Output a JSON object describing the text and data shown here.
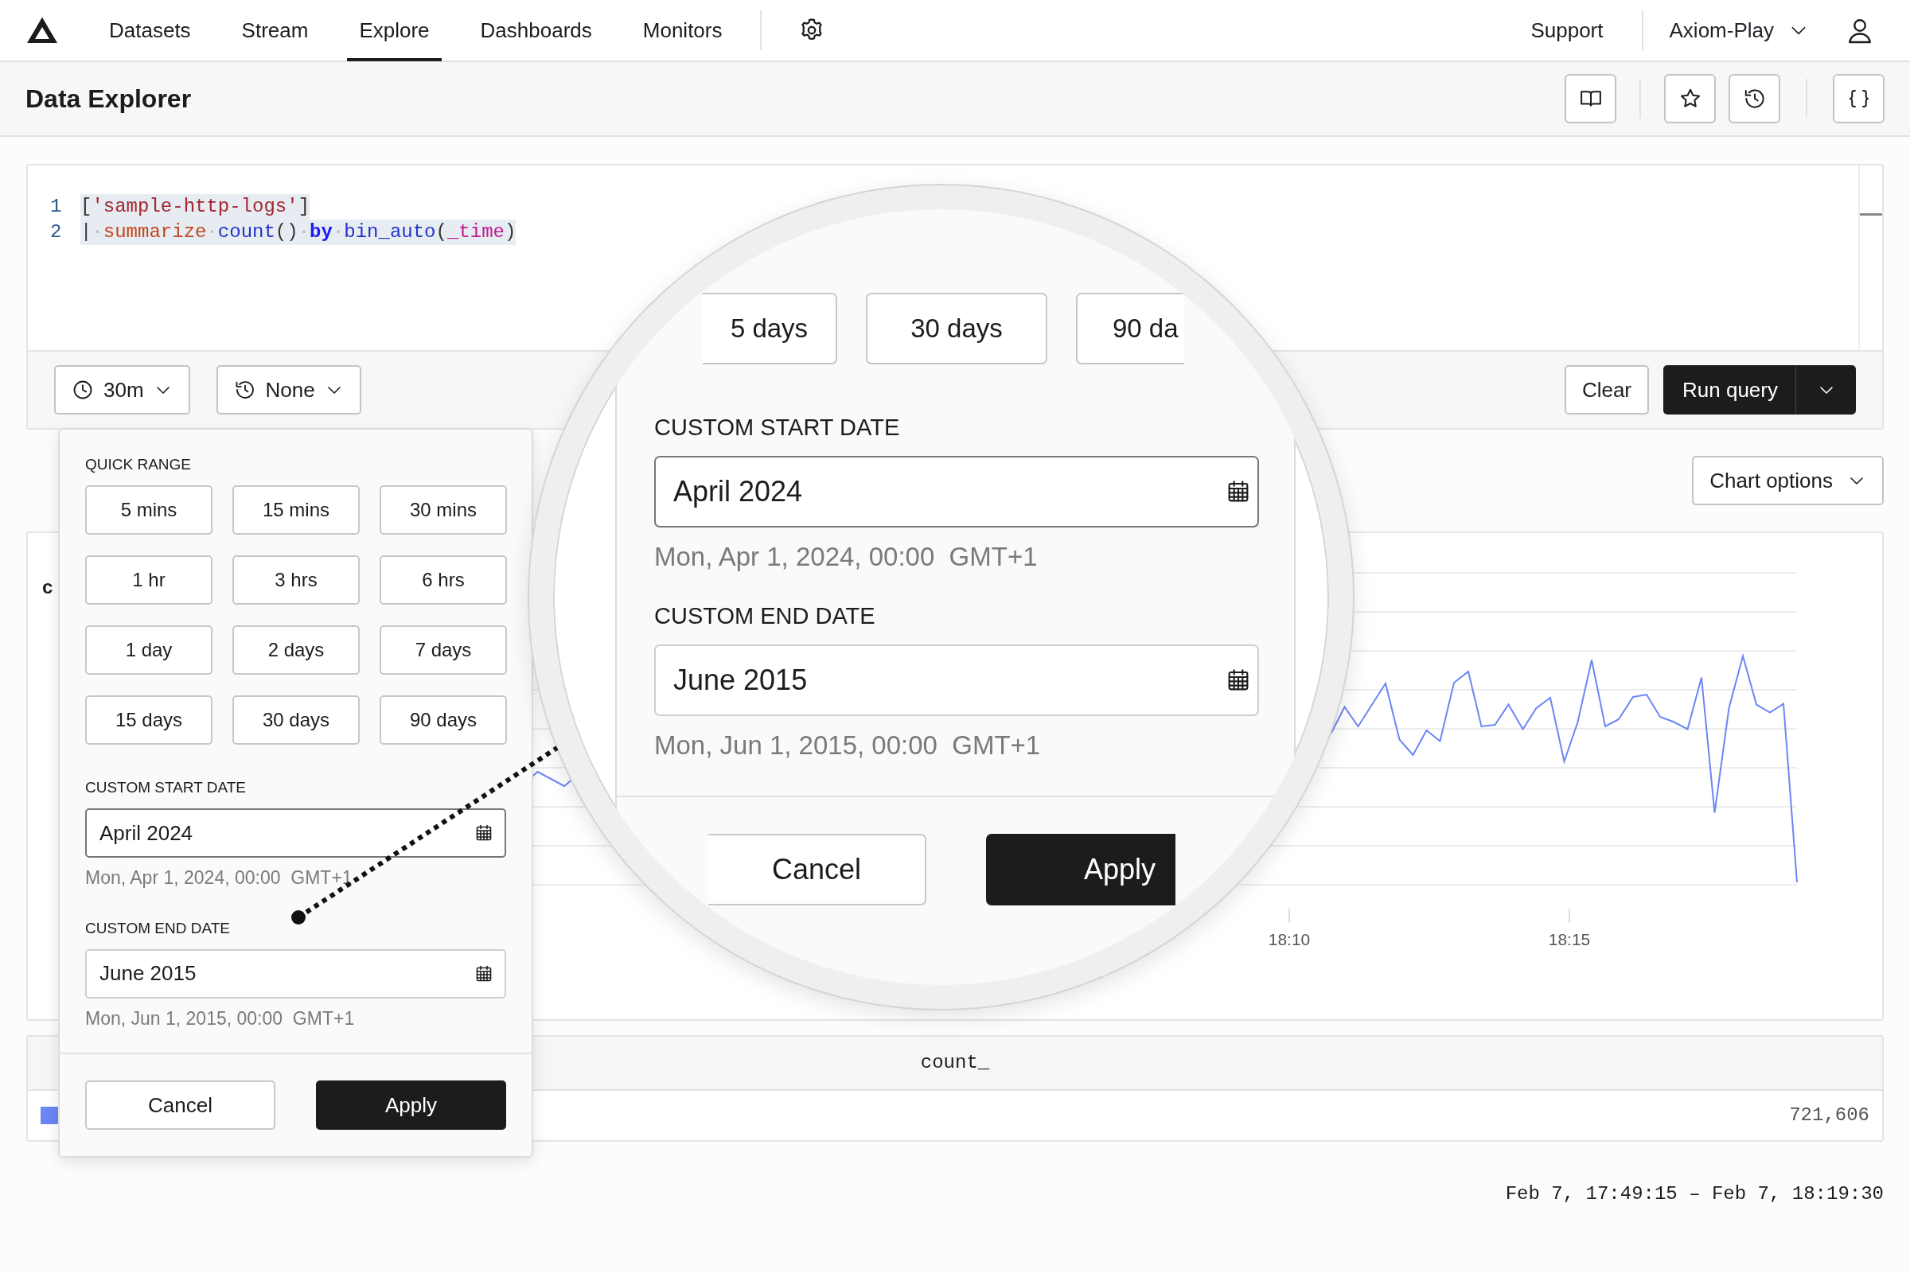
{
  "nav": {
    "items": [
      {
        "label": "Datasets",
        "selected": false
      },
      {
        "label": "Stream",
        "selected": false
      },
      {
        "label": "Explore",
        "selected": true
      },
      {
        "label": "Dashboards",
        "selected": false
      },
      {
        "label": "Monitors",
        "selected": false
      }
    ],
    "support": "Support",
    "workspace": "Axiom-Play"
  },
  "page_title": "Data Explorer",
  "editor": {
    "lines": [
      {
        "number": "1",
        "selected": true,
        "tokens": [
          {
            "kind": "punct",
            "text": "["
          },
          {
            "kind": "string",
            "text": "'sample-http-logs'"
          },
          {
            "kind": "punct",
            "text": "]"
          }
        ]
      },
      {
        "number": "2",
        "selected": true,
        "tokens": [
          {
            "kind": "pipe",
            "text": "|"
          },
          {
            "kind": "space",
            "text": "·"
          },
          {
            "kind": "operator",
            "text": "summarize"
          },
          {
            "kind": "space",
            "text": "·"
          },
          {
            "kind": "function",
            "text": "count"
          },
          {
            "kind": "punct",
            "text": "()"
          },
          {
            "kind": "space",
            "text": "·"
          },
          {
            "kind": "keyword",
            "text": "by"
          },
          {
            "kind": "space",
            "text": "·"
          },
          {
            "kind": "function",
            "text": "bin_auto"
          },
          {
            "kind": "punct",
            "text": "("
          },
          {
            "kind": "field",
            "text": "_time"
          },
          {
            "kind": "punct",
            "text": ")"
          }
        ]
      }
    ]
  },
  "toolbar": {
    "time_range": "30m",
    "compare": "None",
    "clear": "Clear",
    "run": "Run query"
  },
  "popover": {
    "quick_range_label": "QUICK RANGE",
    "quick_ranges": [
      "5 mins",
      "15 mins",
      "30 mins",
      "1 hr",
      "3 hrs",
      "6 hrs",
      "1 day",
      "2 days",
      "7 days",
      "15 days",
      "30 days",
      "90 days"
    ],
    "start": {
      "label": "CUSTOM START DATE",
      "value": "April 2024",
      "hint": "Mon, Apr 1, 2024, 00:00  GMT+1",
      "focused": true
    },
    "end": {
      "label": "CUSTOM END DATE",
      "value": "June 2015",
      "hint": "Mon, Jun 1, 2015, 00:00  GMT+1",
      "focused": false
    },
    "cancel": "Cancel",
    "apply": "Apply"
  },
  "chart_options": "Chart options",
  "chart": {
    "title": "c",
    "x_labels": [
      "18:10",
      "18:15"
    ]
  },
  "table": {
    "columns": [
      "count_"
    ],
    "rows": [
      {
        "color": "#6b86f5",
        "value": "721,606"
      }
    ]
  },
  "footer": "Feb 7, 17:49:15 – Feb 7, 18:19:30",
  "magnifier": {
    "quick_ranges": [
      "5 days",
      "30 days",
      "90 da"
    ],
    "start": {
      "label": "CUSTOM START DATE",
      "value": "April 2024",
      "hint": "Mon, Apr 1, 2024, 00:00  GMT+1",
      "focused": true
    },
    "end": {
      "label": "CUSTOM END DATE",
      "value": "June 2015",
      "hint": "Mon, Jun 1, 2015, 00:00  GMT+1",
      "focused": false
    },
    "cancel": "Cancel",
    "apply": "Apply"
  }
}
